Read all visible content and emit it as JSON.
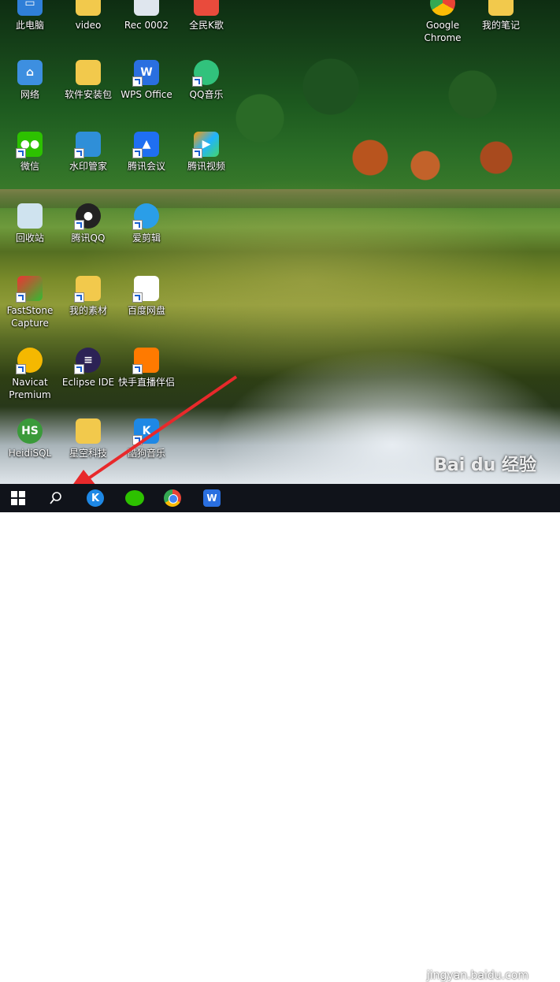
{
  "desktop_icons": [
    {
      "label": "此电脑",
      "icon": "computer-icon"
    },
    {
      "label": "video",
      "icon": "folder-icon"
    },
    {
      "label": "Rec 0002",
      "icon": "video-file-icon"
    },
    {
      "label": "全民K歌",
      "icon": "karaoke-icon"
    },
    {
      "label": "Google Chrome",
      "icon": "chrome-icon"
    },
    {
      "label": "我的笔记",
      "icon": "folder-icon"
    },
    {
      "label": "网络",
      "icon": "network-icon"
    },
    {
      "label": "软件安装包",
      "icon": "folder-icon"
    },
    {
      "label": "WPS Office",
      "icon": "wps-icon"
    },
    {
      "label": "QQ音乐",
      "icon": "qq-music-icon"
    },
    {
      "label": "微信",
      "icon": "wechat-icon"
    },
    {
      "label": "水印管家",
      "icon": "watermark-app-icon"
    },
    {
      "label": "腾讯会议",
      "icon": "tencent-meeting-icon"
    },
    {
      "label": "腾讯视频",
      "icon": "tencent-video-icon"
    },
    {
      "label": "回收站",
      "icon": "recycle-bin-icon"
    },
    {
      "label": "腾讯QQ",
      "icon": "qq-icon"
    },
    {
      "label": "爱剪辑",
      "icon": "video-editor-icon"
    },
    {
      "label": "FastStone Capture",
      "icon": "faststone-icon"
    },
    {
      "label": "我的素材",
      "icon": "folder-icon"
    },
    {
      "label": "百度网盘",
      "icon": "baidu-netdisk-icon"
    },
    {
      "label": "Navicat Premium",
      "icon": "navicat-icon"
    },
    {
      "label": "Eclipse IDE",
      "icon": "eclipse-icon"
    },
    {
      "label": "快手直播伴侣",
      "icon": "kuaishou-icon"
    },
    {
      "label": "HeidiSQL",
      "icon": "heidisql-icon"
    },
    {
      "label": "星空科技",
      "icon": "folder-icon"
    },
    {
      "label": "酷狗音乐",
      "icon": "kugou-icon"
    }
  ],
  "taskbar": {
    "items": [
      {
        "name": "start-button",
        "icon": "windows-start-icon"
      },
      {
        "name": "search-button",
        "icon": "search-icon"
      },
      {
        "name": "kugou",
        "icon": "kugou-icon"
      },
      {
        "name": "wechat",
        "icon": "wechat-icon"
      },
      {
        "name": "chrome",
        "icon": "chrome-icon"
      },
      {
        "name": "wps",
        "icon": "wps-icon"
      }
    ]
  },
  "watermark": {
    "logo_text": "Bai du 经验",
    "url_text": "jingyan.baidu.com"
  },
  "colors": {
    "taskbar": "#10131a",
    "arrow": "#e8292b",
    "accent": "#1e88e5"
  }
}
